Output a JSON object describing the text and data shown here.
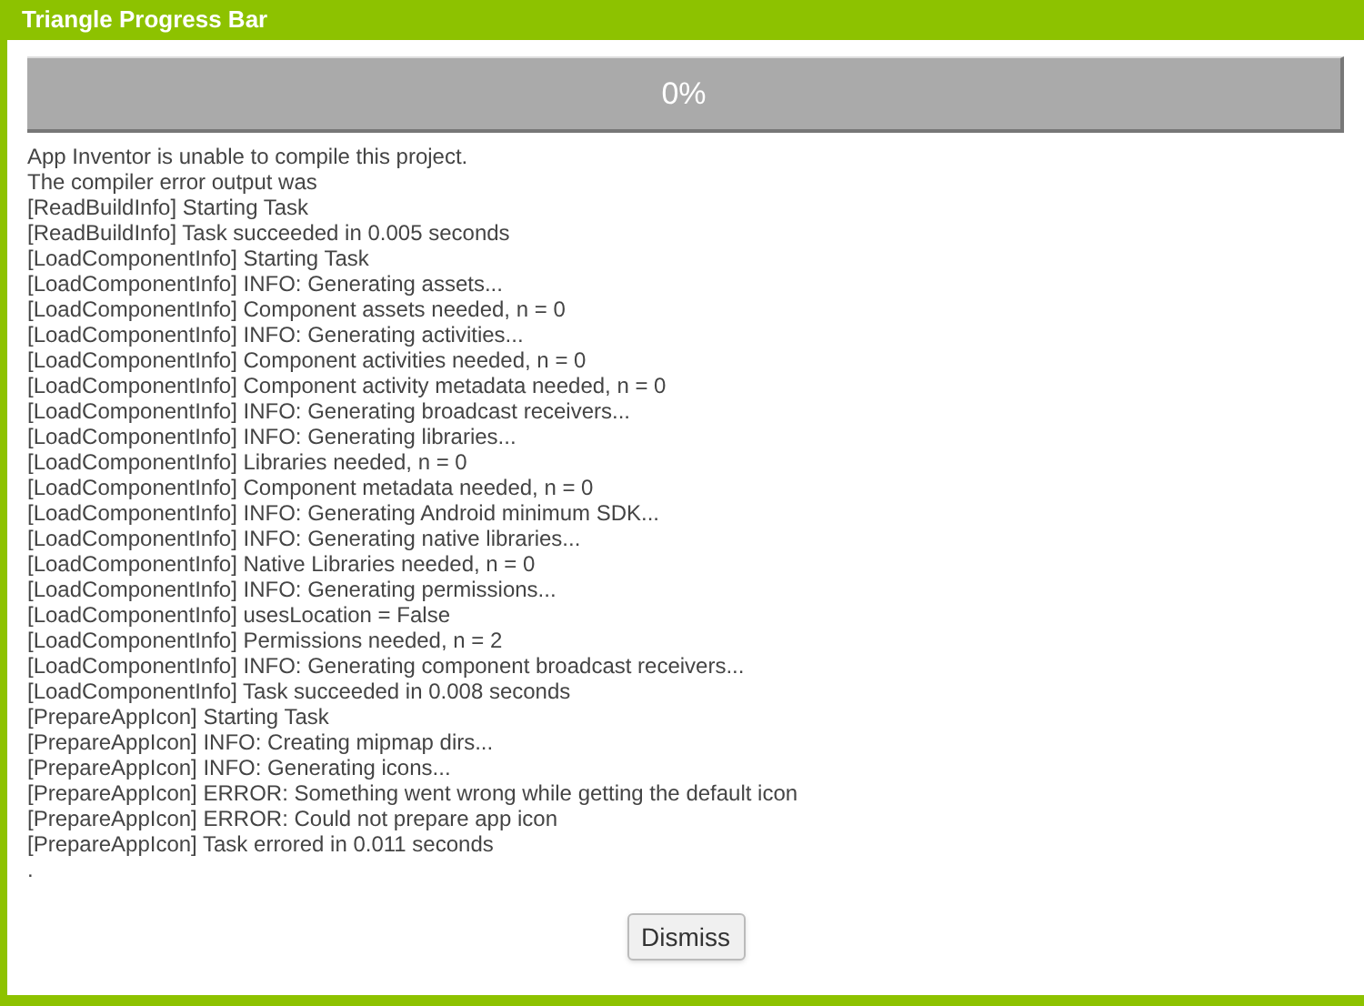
{
  "window": {
    "title": "Triangle Progress Bar"
  },
  "progress": {
    "level": 0,
    "reading": "0%"
  },
  "log_lines": [
    "App Inventor is unable to compile this project.",
    "The compiler error output was",
    "[ReadBuildInfo] Starting Task",
    "[ReadBuildInfo] Task succeeded in 0.005 seconds",
    "[LoadComponentInfo] Starting Task",
    "[LoadComponentInfo] INFO: Generating assets...",
    "[LoadComponentInfo] Component assets needed, n = 0",
    "[LoadComponentInfo] INFO: Generating activities...",
    "[LoadComponentInfo] Component activities needed, n = 0",
    "[LoadComponentInfo] Component activity metadata needed, n = 0",
    "[LoadComponentInfo] INFO: Generating broadcast receivers...",
    "[LoadComponentInfo] INFO: Generating libraries...",
    "[LoadComponentInfo] Libraries needed, n = 0",
    "[LoadComponentInfo] Component metadata needed, n = 0",
    "[LoadComponentInfo] INFO: Generating Android minimum SDK...",
    "[LoadComponentInfo] INFO: Generating native libraries...",
    "[LoadComponentInfo] Native Libraries needed, n = 0",
    "[LoadComponentInfo] INFO: Generating permissions...",
    "[LoadComponentInfo] usesLocation = False",
    "[LoadComponentInfo] Permissions needed, n = 2",
    "[LoadComponentInfo] INFO: Generating component broadcast receivers...",
    "[LoadComponentInfo] Task succeeded in 0.008 seconds",
    "[PrepareAppIcon] Starting Task",
    "[PrepareAppIcon] INFO: Creating mipmap dirs...",
    "[PrepareAppIcon] INFO: Generating icons...",
    "[PrepareAppIcon] ERROR: Something went wrong while getting the default icon",
    "[PrepareAppIcon] ERROR: Could not prepare app icon",
    "[PrepareAppIcon] Task errored in 0.011 seconds",
    "."
  ],
  "buttons": [
    "Dismiss"
  ]
}
